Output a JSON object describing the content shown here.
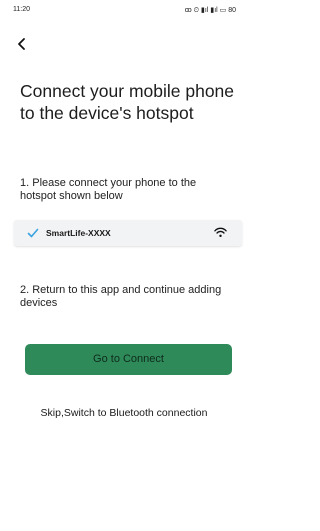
{
  "status_bar": {
    "time": "11:20",
    "icons_text": "ꝏ ⏲ ▮ıl ▮ıl ▭ 80"
  },
  "header": {
    "back_icon": "chevron-left-icon"
  },
  "main": {
    "title": "Connect your mobile phone to the device's hotspot",
    "step1": "1. Please connect your phone to the hotspot shown below",
    "hotspot": {
      "name": "SmartLife-XXXX",
      "check_color": "#3aa3e0",
      "wifi_icon": "wifi-icon"
    },
    "step2": "2. Return to this app and continue adding devices",
    "connect_button": "Go to Connect",
    "skip_link": "Skip,Switch to Bluetooth connection"
  },
  "colors": {
    "accent": "#2f8a5a",
    "card_bg": "#f2f3f5"
  }
}
